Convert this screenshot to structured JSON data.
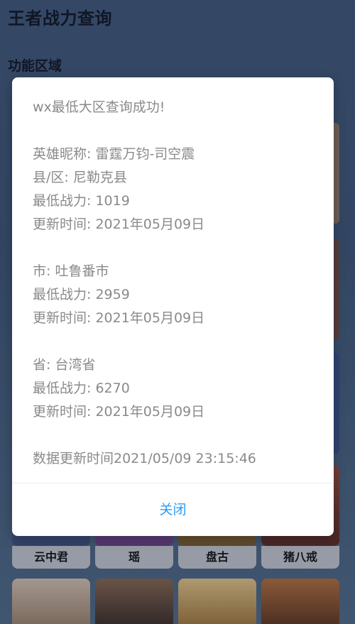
{
  "app": {
    "title": "王者战力查询"
  },
  "section": {
    "title": "功能区域"
  },
  "heroes": [
    {
      "name": "云中君"
    },
    {
      "name": "瑶"
    },
    {
      "name": "盘古"
    },
    {
      "name": "猪八戒"
    }
  ],
  "dialog": {
    "header": "wx最低大区查询成功!",
    "hero_line": "英雄昵称: 雷霆万钧-司空震",
    "county": {
      "region": "县/区: 尼勒克县",
      "power": "最低战力: 1019",
      "updated": "更新时间: 2021年05月09日"
    },
    "city": {
      "region": "市: 吐鲁番市",
      "power": "最低战力: 2959",
      "updated": "更新时间: 2021年05月09日"
    },
    "province": {
      "region": "省: 台湾省",
      "power": "最低战力: 6270",
      "updated": "更新时间: 2021年05月09日"
    },
    "data_updated": "数据更新时间2021/05/09 23:15:46",
    "close_label": "关闭"
  },
  "colors": {
    "accent": "#2b9af3",
    "dialog_text": "#8a8a8a"
  }
}
